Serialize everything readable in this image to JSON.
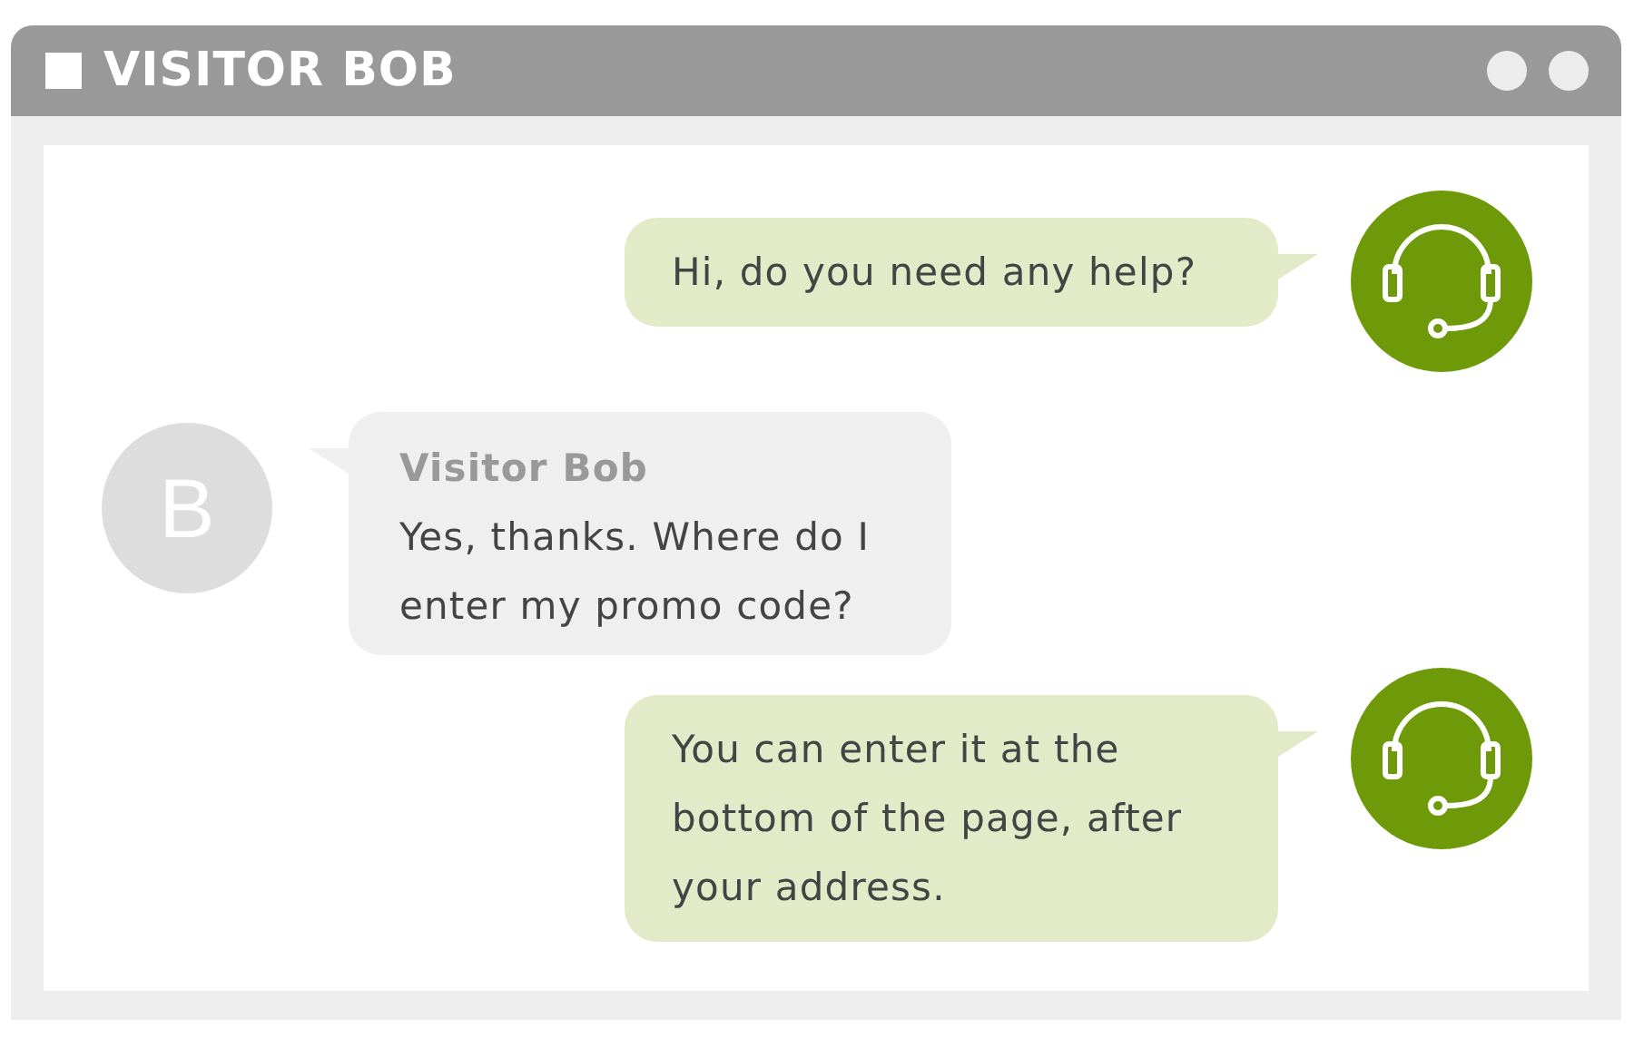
{
  "window": {
    "title": "VISITOR BOB"
  },
  "messages": [
    {
      "kind": "agent",
      "lines": [
        "Hi, do you need any help?"
      ]
    },
    {
      "kind": "visitor",
      "avatar": "B",
      "sender": "Visitor Bob",
      "lines": [
        "Yes, thanks. Where do I",
        "enter my promo code?"
      ]
    },
    {
      "kind": "agent",
      "lines": [
        "You can enter it at the",
        "bottom of the page, after",
        "your address."
      ]
    }
  ]
}
